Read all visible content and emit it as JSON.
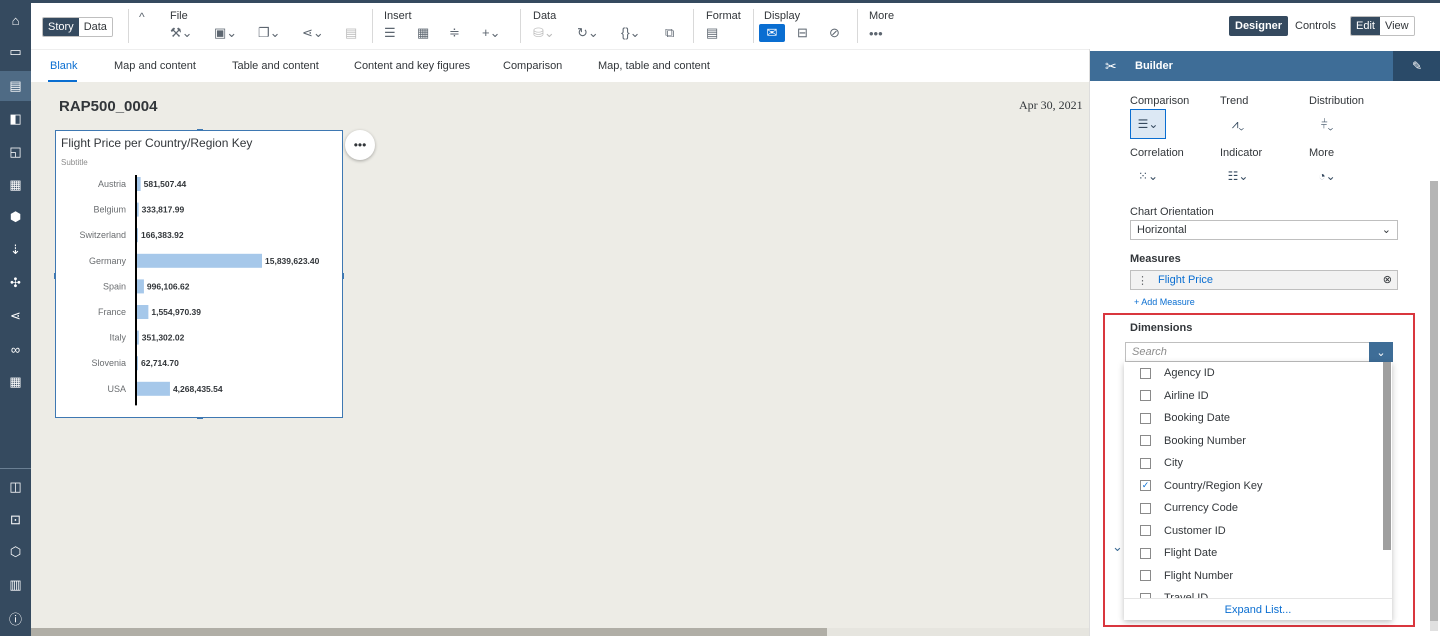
{
  "toolbar": {
    "story_tab": "Story",
    "data_tab": "Data",
    "groups": {
      "file": "File",
      "insert": "Insert",
      "data": "Data",
      "format": "Format",
      "display": "Display",
      "more": "More"
    },
    "designer": "Designer",
    "controls": "Controls",
    "edit": "Edit",
    "view": "View"
  },
  "page_tabs": [
    "Blank",
    "Map and content",
    "Table and content",
    "Content and key figures",
    "Comparison",
    "Map, table and content"
  ],
  "story": {
    "title": "RAP500_0004",
    "date": "Apr 30, 2021"
  },
  "chart_data": {
    "type": "bar",
    "orientation": "horizontal",
    "title": "Flight Price per Country/Region Key",
    "subtitle": "Subtitle",
    "categories": [
      "Austria",
      "Belgium",
      "Switzerland",
      "Germany",
      "Spain",
      "France",
      "Italy",
      "Slovenia",
      "USA"
    ],
    "values": [
      581507.44,
      333817.99,
      166383.92,
      15839623.4,
      996106.62,
      1554970.39,
      351302.02,
      62714.7,
      4268435.54
    ],
    "value_labels": [
      "581,507.44",
      "333,817.99",
      "166,383.92",
      "15,839,623.40",
      "996,106.62",
      "1,554,970.39",
      "351,302.02",
      "62,714.70",
      "4,268,435.54"
    ],
    "bar_color": "#a6c8ea"
  },
  "builder": {
    "title": "Builder",
    "chart_types": [
      {
        "label": "Comparison",
        "icon": "bar-chart-icon",
        "selected": true
      },
      {
        "label": "Trend",
        "icon": "area-chart-icon"
      },
      {
        "label": "Distribution",
        "icon": "box-plot-icon"
      },
      {
        "label": "Correlation",
        "icon": "scatter-chart-icon"
      },
      {
        "label": "Indicator",
        "icon": "bullet-chart-icon"
      },
      {
        "label": "More",
        "icon": "donut-chart-icon"
      }
    ],
    "orientation_label": "Chart Orientation",
    "orientation_value": "Horizontal",
    "measures_label": "Measures",
    "measure": "Flight Price",
    "add_measure": "+ Add Measure",
    "dimensions_label": "Dimensions",
    "search_placeholder": "Search",
    "dimension_options": [
      {
        "label": "Agency ID",
        "checked": false
      },
      {
        "label": "Airline ID",
        "checked": false
      },
      {
        "label": "Booking Date",
        "checked": false
      },
      {
        "label": "Booking Number",
        "checked": false
      },
      {
        "label": "City",
        "checked": false
      },
      {
        "label": "Country/Region Key",
        "checked": true
      },
      {
        "label": "Currency Code",
        "checked": false
      },
      {
        "label": "Customer ID",
        "checked": false
      },
      {
        "label": "Flight Date",
        "checked": false
      },
      {
        "label": "Flight Number",
        "checked": false
      },
      {
        "label": "Travel ID",
        "checked": false
      }
    ],
    "expand_list": "Expand List..."
  }
}
